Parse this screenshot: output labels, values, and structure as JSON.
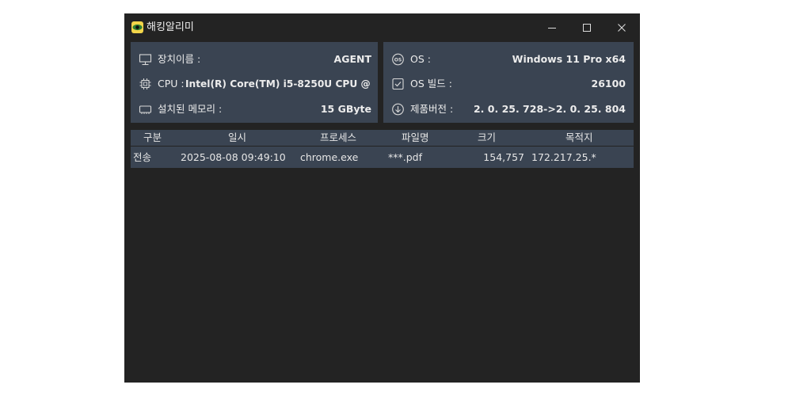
{
  "window": {
    "title": "해킹알리미",
    "icon": "eye-icon"
  },
  "device": {
    "name_label": "장치이름 :",
    "name_value": "AGENT",
    "cpu_label": "CPU :",
    "cpu_value": "Intel(R) Core(TM) i5-8250U CPU @",
    "memory_label": "설치된 메모리 :",
    "memory_value": "15 GByte"
  },
  "system": {
    "os_label": "OS :",
    "os_value": "Windows 11 Pro x64",
    "build_label": "OS 빌드 :",
    "build_value": "26100",
    "version_label": "제품버전 :",
    "version_value": "2. 0. 25. 728->2. 0. 25. 804"
  },
  "table": {
    "columns": [
      "구분",
      "일시",
      "프로세스",
      "파일명",
      "크기",
      "목적지"
    ],
    "rows": [
      [
        "전송",
        "2025-08-08 09:49:10",
        "chrome.exe",
        "***.pdf",
        "154,757",
        "172.217.25.*"
      ]
    ]
  },
  "colors": {
    "window_bg": "#232323",
    "panel_bg": "#3a4452",
    "text": "#e6e6e6"
  }
}
